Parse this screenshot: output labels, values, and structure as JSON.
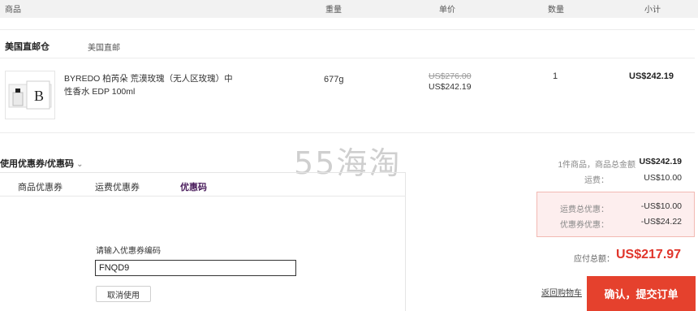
{
  "header": {
    "col_product": "商品",
    "col_weight": "重量",
    "col_unit_price": "单价",
    "col_quantity": "数量",
    "col_subtotal": "小计"
  },
  "warehouse": {
    "name": "美国直邮仓",
    "sub": "美国直邮"
  },
  "product": {
    "image_icon": "perfume-box-icon",
    "image_letter": "B",
    "name": "BYREDO 柏芮朵 荒漠玫瑰（无人区玫瑰）中性香水 EDP 100ml",
    "weight": "677g",
    "original_price": "US$276.00",
    "price": "US$242.19",
    "quantity": "1",
    "subtotal": "US$242.19"
  },
  "watermark": "55海淘",
  "coupon": {
    "toggle_label": "使用优惠券/优惠码",
    "toggle_icon": "chevron-down-icon",
    "tabs": [
      {
        "label": "商品优惠券"
      },
      {
        "label": "运费优惠券"
      },
      {
        "label": "优惠码"
      }
    ],
    "active_tab": "优惠码",
    "code_label": "请输入优惠券编码",
    "code_value": "FNQD9",
    "cancel_label": "取消使用"
  },
  "summary": {
    "items_label": "1件商品，商品总金额",
    "items_value": "US$242.19",
    "shipping_label": "运费：",
    "shipping_value": "US$10.00",
    "shipping_discount_label": "运费总优惠：",
    "shipping_discount_value": "-US$10.00",
    "coupon_discount_label": "优惠券优惠：",
    "coupon_discount_value": "-US$24.22",
    "payable_label": "应付总额：",
    "payable_value": "US$217.97",
    "back_label": "返回购物车",
    "submit_label": "确认，提交订单"
  },
  "colors": {
    "accent": "#e5412d",
    "payable": "#e0352b",
    "discount_bg": "#fdeeee",
    "active_tab": "#4a1d5c"
  }
}
